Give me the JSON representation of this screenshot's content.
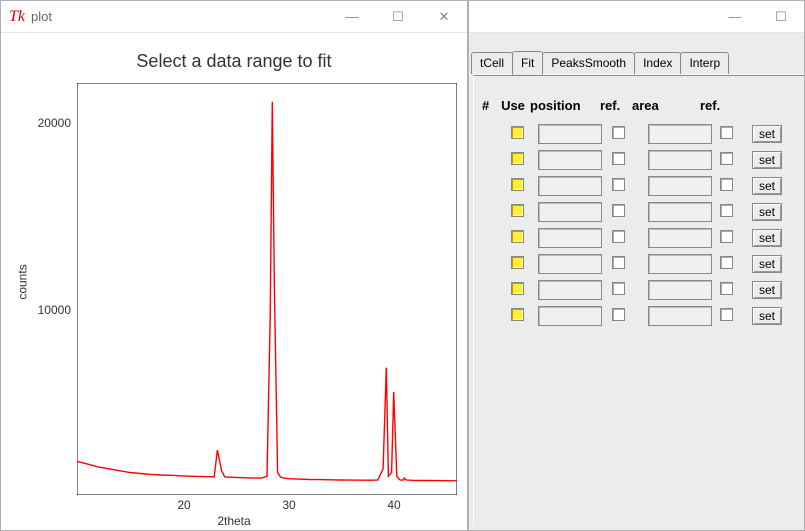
{
  "plot_window": {
    "tk_icon": "Tk",
    "title": "plot",
    "minimize_glyph": "—",
    "maximize_glyph": "☐",
    "close_glyph": "✕"
  },
  "chart": {
    "title": "Select a data range to fit",
    "xlabel": "2theta",
    "ylabel": "counts",
    "y_ticks": [
      10000,
      20000
    ],
    "x_ticks": [
      20,
      30,
      40
    ],
    "y_tick_labels": [
      "10000",
      "20000"
    ],
    "x_tick_labels": [
      "20",
      "30",
      "40"
    ]
  },
  "chart_data": {
    "type": "line",
    "title": "Select a data range to fit",
    "xlabel": "2theta",
    "ylabel": "counts",
    "xlim": [
      10,
      46
    ],
    "ylim": [
      0,
      22000
    ],
    "series": [
      {
        "name": "intensity",
        "color": "#ff0000",
        "x": [
          10,
          11,
          12,
          13,
          14,
          15,
          16,
          17,
          18,
          19,
          20,
          21,
          22,
          23,
          23.3,
          23.7,
          24,
          25,
          26,
          27,
          27.5,
          28,
          28.3,
          28.5,
          28.7,
          29,
          29.3,
          29.6,
          30,
          31,
          32,
          33,
          34,
          35,
          36,
          37,
          38,
          38.5,
          39,
          39.3,
          39.5,
          39.8,
          40,
          40.3,
          40.6,
          40.9,
          41.0,
          41.2,
          41.5,
          42,
          43,
          44,
          45,
          46
        ],
        "y": [
          1800,
          1650,
          1500,
          1400,
          1300,
          1200,
          1150,
          1100,
          1070,
          1050,
          1020,
          1000,
          980,
          970,
          2400,
          1300,
          960,
          940,
          920,
          900,
          900,
          1000,
          9500,
          21000,
          11000,
          1200,
          950,
          900,
          870,
          850,
          830,
          820,
          810,
          800,
          795,
          790,
          790,
          800,
          1400,
          6800,
          1000,
          1200,
          5500,
          1000,
          800,
          790,
          900,
          800,
          790,
          780,
          775,
          770,
          765,
          760
        ]
      }
    ]
  },
  "panel_window": {
    "minimize_glyph": "—",
    "maximize_glyph": "☐"
  },
  "tabs": [
    {
      "id": "tcell",
      "label": "tCell",
      "active": false
    },
    {
      "id": "fit",
      "label": "Fit",
      "active": true
    },
    {
      "id": "peaks",
      "label": "PeaksSmooth",
      "active": false
    },
    {
      "id": "index",
      "label": "Index",
      "active": false
    },
    {
      "id": "interp",
      "label": "Interp",
      "active": false
    }
  ],
  "table": {
    "headers": {
      "num": "#",
      "use": "Use",
      "position": "position",
      "ref1": "ref.",
      "area": "area",
      "ref2": "ref.",
      "set": ""
    },
    "set_label": "set",
    "rows": [
      {
        "use": false,
        "position": "",
        "ref1": false,
        "area": "",
        "ref2": false
      },
      {
        "use": false,
        "position": "",
        "ref1": false,
        "area": "",
        "ref2": false
      },
      {
        "use": false,
        "position": "",
        "ref1": false,
        "area": "",
        "ref2": false
      },
      {
        "use": false,
        "position": "",
        "ref1": false,
        "area": "",
        "ref2": false
      },
      {
        "use": false,
        "position": "",
        "ref1": false,
        "area": "",
        "ref2": false
      },
      {
        "use": false,
        "position": "",
        "ref1": false,
        "area": "",
        "ref2": false
      },
      {
        "use": false,
        "position": "",
        "ref1": false,
        "area": "",
        "ref2": false
      },
      {
        "use": false,
        "position": "",
        "ref1": false,
        "area": "",
        "ref2": false
      }
    ]
  }
}
